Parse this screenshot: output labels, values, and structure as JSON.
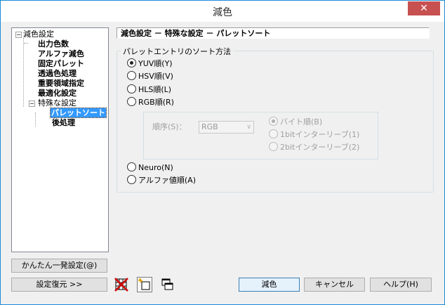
{
  "window": {
    "title": "減色",
    "close_icon": "✕"
  },
  "tree": {
    "items": [
      {
        "label": "減色設定",
        "expander": "−"
      },
      {
        "label": "出力色数"
      },
      {
        "label": "アルファ減色"
      },
      {
        "label": "固定パレット"
      },
      {
        "label": "透過色処理"
      },
      {
        "label": "重要領域指定"
      },
      {
        "label": "最適化設定"
      },
      {
        "label": "特殊な設定",
        "expander": "−"
      },
      {
        "label": "パレットソート",
        "selected": true
      },
      {
        "label": "後処理"
      }
    ]
  },
  "header": {
    "breadcrumb": "減色設定 － 特殊な設定 － パレットソート"
  },
  "sort": {
    "group_title": "パレットエントリのソート方法",
    "options": [
      {
        "label": "YUV順(Y)",
        "checked": true
      },
      {
        "label": "HSV順(V)",
        "checked": false
      },
      {
        "label": "HLS順(L)",
        "checked": false
      },
      {
        "label": "RGB順(R)",
        "checked": false
      },
      {
        "label": "Neuro(N)",
        "checked": false
      },
      {
        "label": "アルファ値順(A)",
        "checked": false
      }
    ],
    "rgb": {
      "order_label": "順序(S)：",
      "order_value": "RGB",
      "byte_options": [
        {
          "label": "バイト順(B)",
          "checked": true
        },
        {
          "label": "1bitインターリーブ(1)",
          "checked": false
        },
        {
          "label": "2bitインターリーブ(2)",
          "checked": false
        }
      ]
    }
  },
  "buttons": {
    "easy": "かんたん一発設定(@)",
    "restore": "設定復元 >>",
    "ok": "減色",
    "cancel": "キャンセル",
    "help": "ヘルプ(H)"
  },
  "icons": {
    "delete": "delete-palette-icon",
    "new": "new-item-icon",
    "copy": "copy-windows-icon"
  }
}
